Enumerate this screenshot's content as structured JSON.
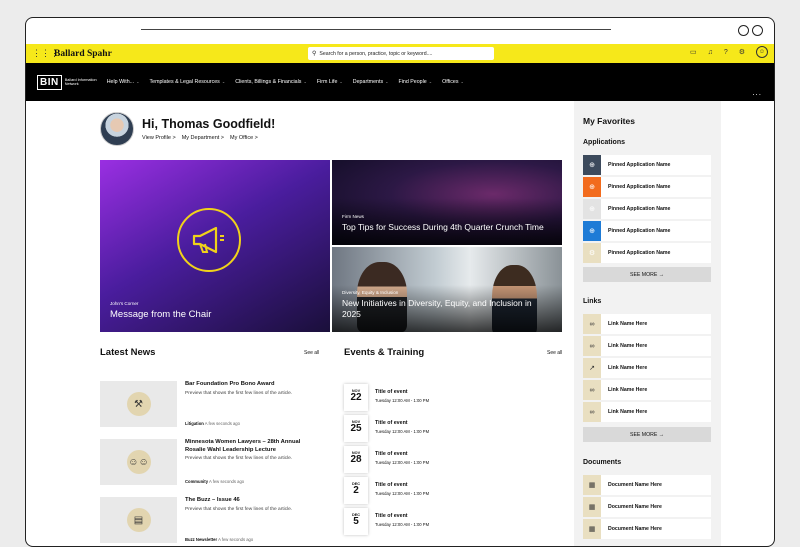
{
  "topbar": {
    "brand": "Ballard Spahr",
    "search_placeholder": "Search for a person, practice, topic or keyword...."
  },
  "nav": {
    "logo": "BIN",
    "logo_text": "Ballard Information Network",
    "items": [
      "Help With...",
      "Templates & Legal Resources",
      "Clients, Billings & Financials",
      "Firm Life",
      "Departments",
      "Find People",
      "Offices"
    ],
    "more": "..."
  },
  "greeting": {
    "title": "Hi, Thomas Goodfield!",
    "links": [
      "View Profile >",
      "My Department >",
      "My Office >"
    ]
  },
  "tiles": [
    {
      "category": "John's Corner",
      "title": "Message from the Chair"
    },
    {
      "category": "Firm News",
      "title": "Top Tips for Success During 4th Quarter Crunch Time"
    },
    {
      "category": "Diversity, Equity & Inclusion",
      "title": "New Initiatives in Diversity, Equity, and Inclusion in 2025"
    }
  ],
  "latest_news": {
    "heading": "Latest News",
    "see_all": "See all",
    "items": [
      {
        "title": "Bar Foundation Pro Bono Award",
        "preview": "Preview that shows the first few lines of the article.",
        "tag": "Litigation",
        "time": "A few seconds ago",
        "icon": "gavel-icon"
      },
      {
        "title": "Minnesota Women Lawyers – 28th Annual Rosalie Wahl Leadership Lecture",
        "preview": "Preview that shows the first few lines of the article.",
        "tag": "Community",
        "time": "A few seconds ago",
        "icon": "people-icon"
      },
      {
        "title": "The Buzz – Issue 46",
        "preview": "Preview that shows the first few lines of the article.",
        "tag": "Buzz Newsletter",
        "time": "A few seconds ago",
        "icon": "newsletter-icon"
      }
    ]
  },
  "events": {
    "heading": "Events & Training",
    "see_all": "See all",
    "items": [
      {
        "month": "NOV",
        "day": "22",
        "title": "Title of event",
        "time": "Tuesday 12:00 AM - 1:00 PM"
      },
      {
        "month": "NOV",
        "day": "25",
        "title": "Title of event",
        "time": "Tuesday 12:00 AM - 1:00 PM"
      },
      {
        "month": "NOV",
        "day": "28",
        "title": "Title of event",
        "time": "Tuesday 12:00 AM - 1:00 PM"
      },
      {
        "month": "DEC",
        "day": "2",
        "title": "Title of event",
        "time": "Tuesday 12:00 AM - 1:00 PM"
      },
      {
        "month": "DEC",
        "day": "5",
        "title": "Title of event",
        "time": "Tuesday 12:00 AM - 1:00 PM"
      }
    ]
  },
  "favorites": {
    "heading": "My Favorites",
    "applications": {
      "heading": "Applications",
      "items": [
        {
          "label": "Pinned Application Name",
          "color": "#3c4a5c"
        },
        {
          "label": "Pinned Application Name",
          "color": "#f26b1d"
        },
        {
          "label": "Pinned Application Name",
          "color": "#e3e3e3"
        },
        {
          "label": "Pinned Application Name",
          "color": "#1e7bd6"
        },
        {
          "label": "Pinned Application Name",
          "color": "#e9dfc1"
        }
      ],
      "see_more": "SEE MORE →"
    },
    "links": {
      "heading": "Links",
      "items": [
        "Link Name Here",
        "Link Name Here",
        "Link Name Here",
        "Link Name Here",
        "Link Name Here"
      ],
      "see_more": "SEE MORE →"
    },
    "documents": {
      "heading": "Documents",
      "items": [
        "Document Name Here",
        "Document Name Here",
        "Document Name Here"
      ]
    }
  }
}
